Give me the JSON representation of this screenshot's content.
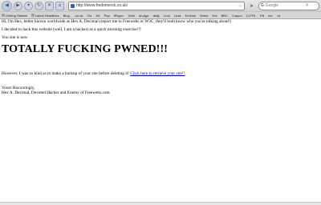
{
  "browser": {
    "url": "http://www.fredomerck.co.uk/",
    "search_placeholder": "Google",
    "bookmarks": [
      "Getting Started",
      "Latest Headlines",
      "Blog",
      "..co.uk",
      "Ctz",
      "N4",
      "Pop",
      "iPlayer",
      "Tube",
      "drudge",
      "daily",
      "Cool",
      "Leak",
      "Erekink",
      "Wired",
      "Hot",
      "BBC",
      "Crayon",
      "CLTRL",
      "Eff",
      "ree",
      "»d"
    ]
  },
  "page": {
    "intro": "Hi, I'm Hex, better known worldwide as Hex A. Decimal (report me to Freewebs or W3C, they'll both know who you're talking about!)",
    "hack_line": "I decided to hack this website (well, I am a hacker) as a quick morning exercise!!!",
    "now_line": "You site is now",
    "headline": "TOTALLY FUCKING PWNED!!!",
    "backup_text": "However, I was so kind as to make a backup of your site before deleting it!",
    "backup_link": "Click here to retrieve your site!!",
    "sign_off": "Yours Haxxoringly,",
    "signature": "Hex A. Decimal, Devoted Hacker and Enemy of Freewebs.com"
  }
}
